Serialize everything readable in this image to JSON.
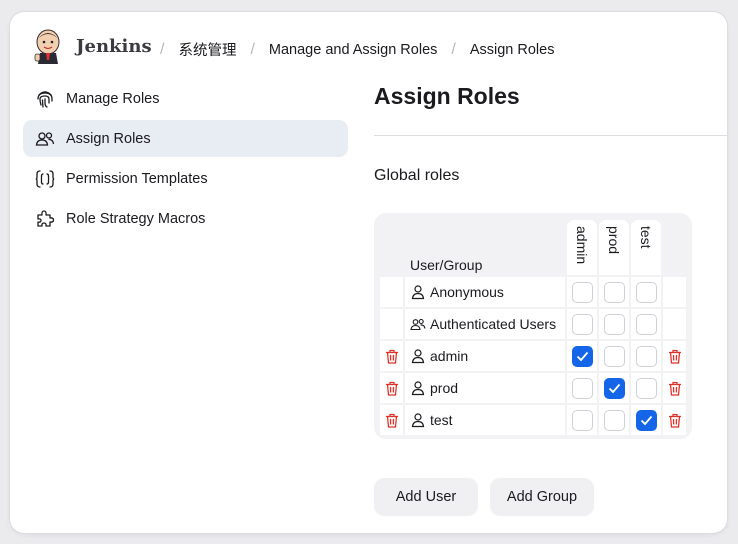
{
  "header": {
    "brand": "Jenkins",
    "breadcrumbs": [
      "系统管理",
      "Manage and Assign Roles",
      "Assign Roles"
    ]
  },
  "sidebar": {
    "items": [
      {
        "label": "Manage Roles",
        "icon": "fingerprint-icon",
        "active": false
      },
      {
        "label": "Assign Roles",
        "icon": "users-icon",
        "active": true
      },
      {
        "label": "Permission Templates",
        "icon": "braces-icon",
        "active": false
      },
      {
        "label": "Role Strategy Macros",
        "icon": "puzzle-icon",
        "active": false
      }
    ]
  },
  "main": {
    "title": "Assign Roles",
    "section_title": "Global roles",
    "table": {
      "user_group_header": "User/Group",
      "roles": [
        "admin",
        "prod",
        "test"
      ],
      "rows": [
        {
          "name": "Anonymous",
          "icon": "user-icon",
          "deletable": false,
          "assigned": [
            false,
            false,
            false
          ]
        },
        {
          "name": "Authenticated Users",
          "icon": "group-icon",
          "deletable": false,
          "assigned": [
            false,
            false,
            false
          ]
        },
        {
          "name": "admin",
          "icon": "user-icon",
          "deletable": true,
          "assigned": [
            true,
            false,
            false
          ]
        },
        {
          "name": "prod",
          "icon": "user-icon",
          "deletable": true,
          "assigned": [
            false,
            true,
            false
          ]
        },
        {
          "name": "test",
          "icon": "user-icon",
          "deletable": true,
          "assigned": [
            false,
            false,
            true
          ]
        }
      ]
    },
    "add_user_label": "Add User",
    "add_group_label": "Add Group"
  },
  "colors": {
    "accent": "#1565e8",
    "delete": "#e0322b",
    "active_bg": "#e8ecf3"
  }
}
